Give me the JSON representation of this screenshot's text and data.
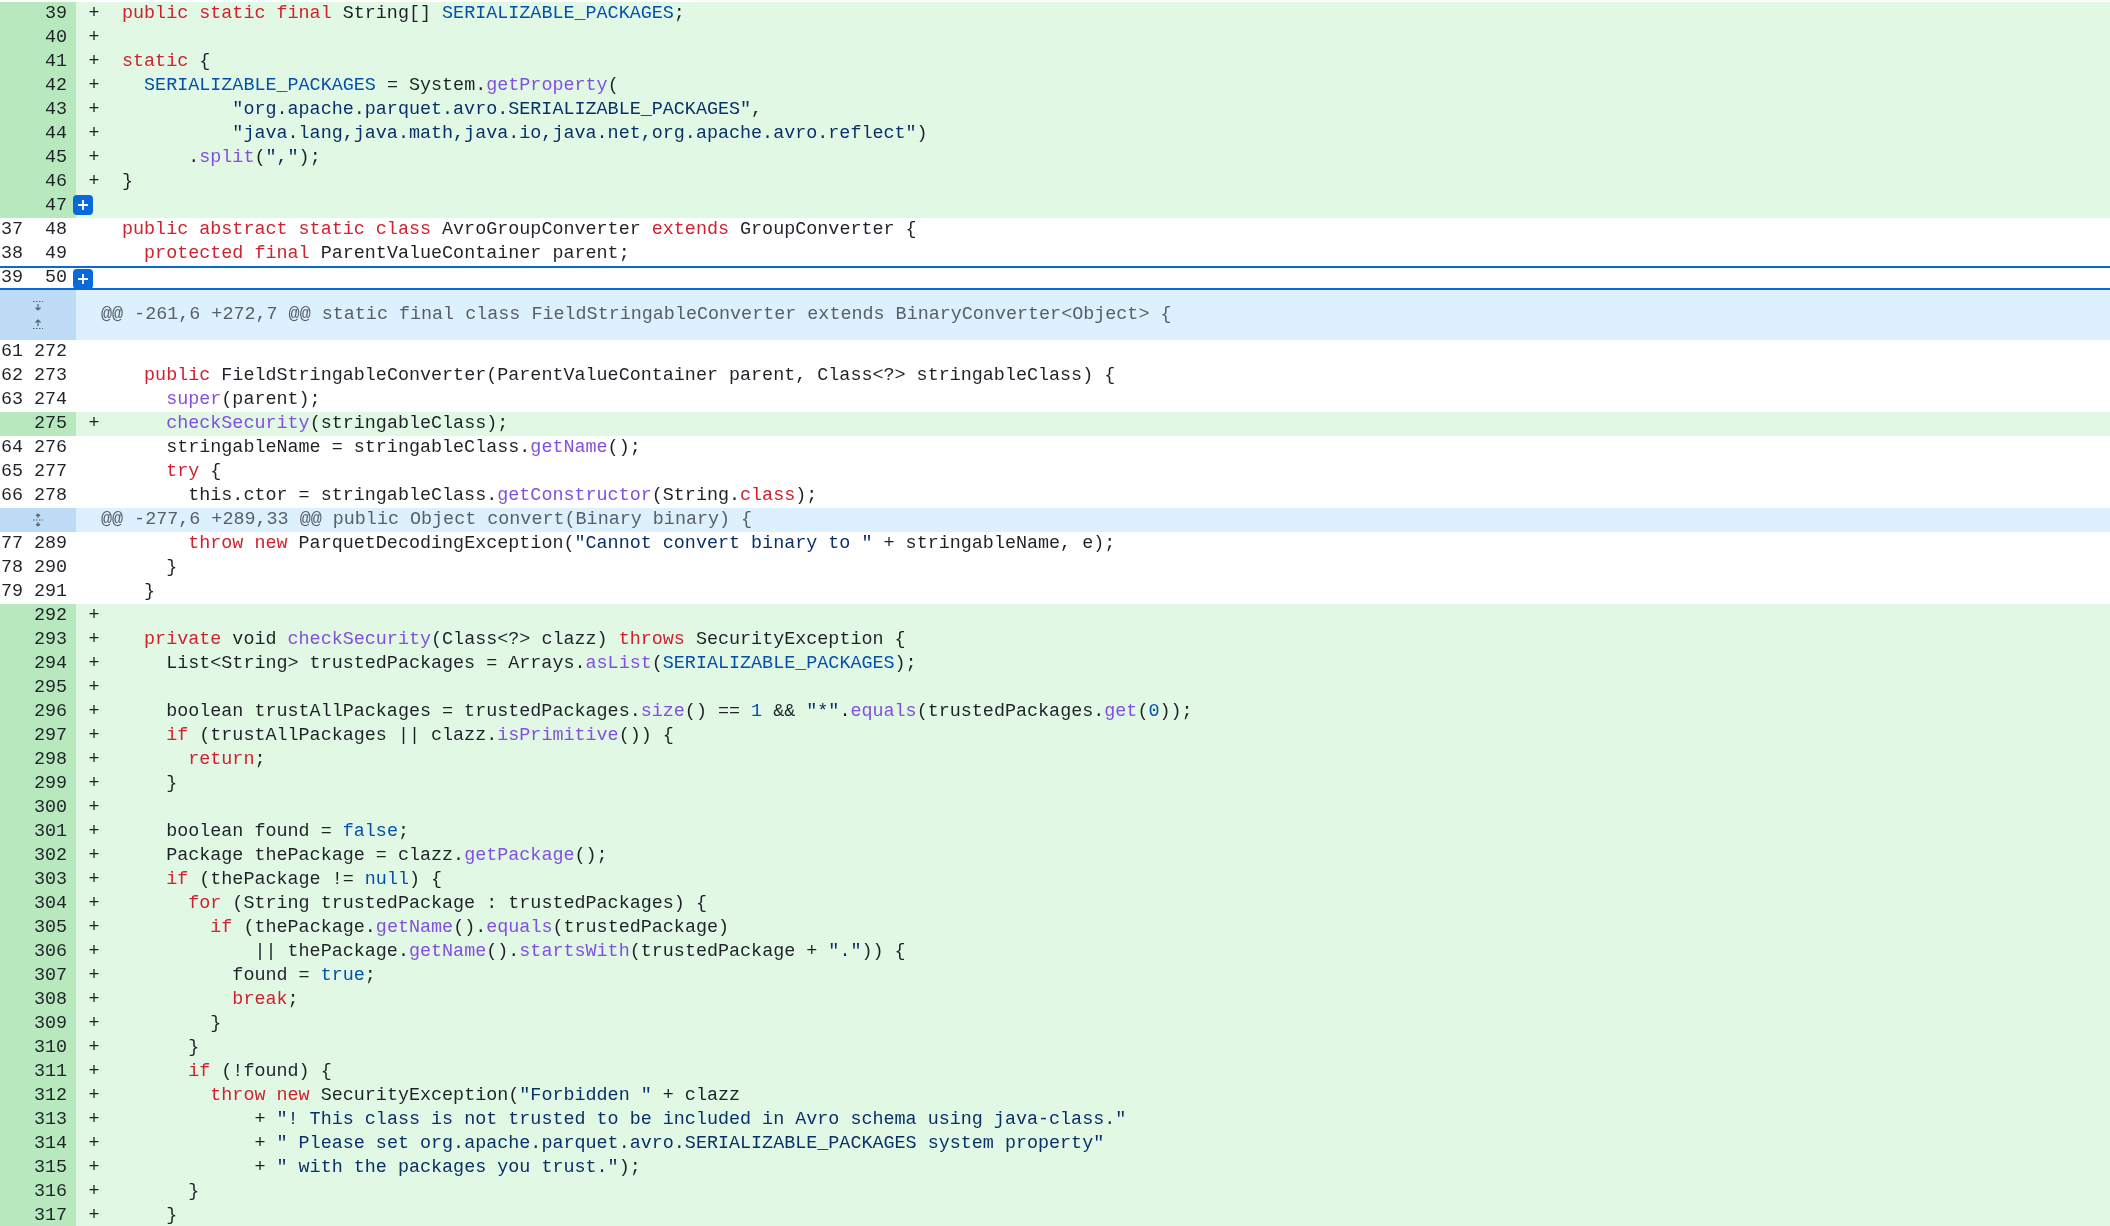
{
  "diff_lines": [
    {
      "kind": "added",
      "new": "39",
      "marker": "+",
      "selected": false,
      "comment_button": false,
      "code": [
        {
          "kind": "kw",
          "text": "public static final"
        },
        {
          "kind": "plain",
          "text": " String[] "
        },
        {
          "kind": "const",
          "text": "SERIALIZABLE_PACKAGES"
        },
        {
          "kind": "plain",
          "text": ";"
        }
      ]
    },
    {
      "kind": "added",
      "new": "40",
      "marker": "+",
      "selected": false,
      "comment_button": false
    },
    {
      "kind": "added",
      "new": "41",
      "marker": "+",
      "selected": false,
      "comment_button": false,
      "code": [
        {
          "kind": "kw",
          "text": "static"
        },
        {
          "kind": "plain",
          "text": " {"
        }
      ]
    },
    {
      "kind": "added",
      "new": "42",
      "marker": "+",
      "selected": false,
      "comment_button": false,
      "code": [
        {
          "kind": "const",
          "text": "  SERIALIZABLE_PACKAGES"
        },
        {
          "kind": "plain",
          "text": " = System."
        },
        {
          "kind": "fn",
          "text": "getProperty"
        },
        {
          "kind": "plain",
          "text": "("
        }
      ]
    },
    {
      "kind": "added",
      "new": "43",
      "marker": "+",
      "selected": false,
      "comment_button": false,
      "code": [
        {
          "kind": "str",
          "text": "          \"org.apache.parquet.avro.SERIALIZABLE_PACKAGES\""
        },
        {
          "kind": "plain",
          "text": ","
        }
      ]
    },
    {
      "kind": "added",
      "new": "44",
      "marker": "+",
      "selected": false,
      "comment_button": false,
      "code": [
        {
          "kind": "str",
          "text": "          \"java.lang,java.math,java.io,java.net,org.apache.avro.reflect\""
        },
        {
          "kind": "plain",
          "text": ")"
        }
      ]
    },
    {
      "kind": "added",
      "new": "45",
      "marker": "+",
      "selected": false,
      "comment_button": false,
      "code": [
        {
          "kind": "plain",
          "text": "      ."
        },
        {
          "kind": "fn",
          "text": "split"
        },
        {
          "kind": "plain",
          "text": "("
        },
        {
          "kind": "str",
          "text": "\",\""
        },
        {
          "kind": "plain",
          "text": ");"
        }
      ]
    },
    {
      "kind": "added",
      "new": "46",
      "marker": "+",
      "selected": false,
      "comment_button": false,
      "code": [
        {
          "kind": "plain",
          "text": "}"
        }
      ]
    },
    {
      "kind": "added",
      "new": "47",
      "selected": false,
      "comment_button": true
    },
    {
      "kind": "context",
      "old": "37",
      "new": "48",
      "selected": false,
      "comment_button": false,
      "code": [
        {
          "kind": "kw",
          "text": "public abstract static class"
        },
        {
          "kind": "plain",
          "text": " AvroGroupConverter "
        },
        {
          "kind": "kw",
          "text": "extends"
        },
        {
          "kind": "plain",
          "text": " GroupConverter {"
        }
      ]
    },
    {
      "kind": "context",
      "old": "38",
      "new": "49",
      "selected": false,
      "comment_button": false,
      "code": [
        {
          "kind": "kw",
          "text": "  protected final"
        },
        {
          "kind": "plain",
          "text": " ParentValueContainer parent;"
        }
      ]
    },
    {
      "kind": "context",
      "old": "39",
      "new": "50",
      "selected": true,
      "comment_button": true
    },
    {
      "kind": "hunk_split",
      "header": "@@ -261,6 +272,7 @@ static final class FieldStringableConverter extends BinaryConverter<Object> {"
    },
    {
      "kind": "context",
      "old": "61",
      "new": "272",
      "selected": false,
      "comment_button": false
    },
    {
      "kind": "context",
      "old": "62",
      "new": "273",
      "selected": false,
      "comment_button": false,
      "code": [
        {
          "kind": "kw",
          "text": "  public"
        },
        {
          "kind": "plain",
          "text": " FieldStringableConverter(ParentValueContainer parent, Class<?> stringableClass) {"
        }
      ]
    },
    {
      "kind": "context",
      "old": "63",
      "new": "274",
      "selected": false,
      "comment_button": false,
      "code": [
        {
          "kind": "fn",
          "text": "    super"
        },
        {
          "kind": "plain",
          "text": "(parent);"
        }
      ]
    },
    {
      "kind": "added",
      "new": "275",
      "marker": "+",
      "selected": false,
      "comment_button": false,
      "code": [
        {
          "kind": "fn",
          "text": "    checkSecurity"
        },
        {
          "kind": "plain",
          "text": "(stringableClass);"
        }
      ]
    },
    {
      "kind": "context",
      "old": "64",
      "new": "276",
      "selected": false,
      "comment_button": false,
      "code": [
        {
          "kind": "plain",
          "text": "    stringableName = stringableClass."
        },
        {
          "kind": "fn",
          "text": "getName"
        },
        {
          "kind": "plain",
          "text": "();"
        }
      ]
    },
    {
      "kind": "context",
      "old": "65",
      "new": "277",
      "selected": false,
      "comment_button": false,
      "code": [
        {
          "kind": "kw",
          "text": "    try"
        },
        {
          "kind": "plain",
          "text": " {"
        }
      ]
    },
    {
      "kind": "context",
      "old": "66",
      "new": "278",
      "selected": false,
      "comment_button": false,
      "code": [
        {
          "kind": "plain",
          "text": "      this.ctor = stringableClass."
        },
        {
          "kind": "fn",
          "text": "getConstructor"
        },
        {
          "kind": "plain",
          "text": "(String."
        },
        {
          "kind": "kw",
          "text": "class"
        },
        {
          "kind": "plain",
          "text": ");"
        }
      ]
    },
    {
      "kind": "hunk_combined",
      "header": "@@ -277,6 +289,33 @@ public Object convert(Binary binary) {"
    },
    {
      "kind": "context",
      "old": "77",
      "new": "289",
      "selected": false,
      "comment_button": false,
      "code": [
        {
          "kind": "kw",
          "text": "      throw new"
        },
        {
          "kind": "plain",
          "text": " ParquetDecodingException("
        },
        {
          "kind": "str",
          "text": "\"Cannot convert binary to \""
        },
        {
          "kind": "plain",
          "text": " + stringableName, e);"
        }
      ]
    },
    {
      "kind": "context",
      "old": "78",
      "new": "290",
      "selected": false,
      "comment_button": false,
      "code": [
        {
          "kind": "plain",
          "text": "    }"
        }
      ]
    },
    {
      "kind": "context",
      "old": "79",
      "new": "291",
      "selected": false,
      "comment_button": false,
      "code": [
        {
          "kind": "plain",
          "text": "  }"
        }
      ]
    },
    {
      "kind": "added",
      "new": "292",
      "marker": "+",
      "selected": false,
      "comment_button": false
    },
    {
      "kind": "added",
      "new": "293",
      "marker": "+",
      "selected": false,
      "comment_button": false,
      "code": [
        {
          "kind": "kw",
          "text": "  private"
        },
        {
          "kind": "plain",
          "text": " void "
        },
        {
          "kind": "fn",
          "text": "checkSecurity"
        },
        {
          "kind": "plain",
          "text": "(Class<?> clazz) "
        },
        {
          "kind": "kw",
          "text": "throws"
        },
        {
          "kind": "plain",
          "text": " SecurityException {"
        }
      ]
    },
    {
      "kind": "added",
      "new": "294",
      "marker": "+",
      "selected": false,
      "comment_button": false,
      "code": [
        {
          "kind": "plain",
          "text": "    List<String> trustedPackages = Arrays."
        },
        {
          "kind": "fn",
          "text": "asList"
        },
        {
          "kind": "plain",
          "text": "("
        },
        {
          "kind": "const",
          "text": "SERIALIZABLE_PACKAGES"
        },
        {
          "kind": "plain",
          "text": ");"
        }
      ]
    },
    {
      "kind": "added",
      "new": "295",
      "marker": "+",
      "selected": false,
      "comment_button": false
    },
    {
      "kind": "added",
      "new": "296",
      "marker": "+",
      "selected": false,
      "comment_button": false,
      "code": [
        {
          "kind": "plain",
          "text": "    boolean trustAllPackages = trustedPackages."
        },
        {
          "kind": "fn",
          "text": "size"
        },
        {
          "kind": "plain",
          "text": "() == "
        },
        {
          "kind": "const",
          "text": "1"
        },
        {
          "kind": "plain",
          "text": " && "
        },
        {
          "kind": "str",
          "text": "\"*\""
        },
        {
          "kind": "plain",
          "text": "."
        },
        {
          "kind": "fn",
          "text": "equals"
        },
        {
          "kind": "plain",
          "text": "(trustedPackages."
        },
        {
          "kind": "fn",
          "text": "get"
        },
        {
          "kind": "plain",
          "text": "("
        },
        {
          "kind": "const",
          "text": "0"
        },
        {
          "kind": "plain",
          "text": "));"
        }
      ]
    },
    {
      "kind": "added",
      "new": "297",
      "marker": "+",
      "selected": false,
      "comment_button": false,
      "code": [
        {
          "kind": "kw",
          "text": "    if"
        },
        {
          "kind": "plain",
          "text": " (trustAllPackages || clazz."
        },
        {
          "kind": "fn",
          "text": "isPrimitive"
        },
        {
          "kind": "plain",
          "text": "()) {"
        }
      ]
    },
    {
      "kind": "added",
      "new": "298",
      "marker": "+",
      "selected": false,
      "comment_button": false,
      "code": [
        {
          "kind": "kw",
          "text": "      return"
        },
        {
          "kind": "plain",
          "text": ";"
        }
      ]
    },
    {
      "kind": "added",
      "new": "299",
      "marker": "+",
      "selected": false,
      "comment_button": false,
      "code": [
        {
          "kind": "plain",
          "text": "    }"
        }
      ]
    },
    {
      "kind": "added",
      "new": "300",
      "marker": "+",
      "selected": false,
      "comment_button": false
    },
    {
      "kind": "added",
      "new": "301",
      "marker": "+",
      "selected": false,
      "comment_button": false,
      "code": [
        {
          "kind": "plain",
          "text": "    boolean found = "
        },
        {
          "kind": "const",
          "text": "false"
        },
        {
          "kind": "plain",
          "text": ";"
        }
      ]
    },
    {
      "kind": "added",
      "new": "302",
      "marker": "+",
      "selected": false,
      "comment_button": false,
      "code": [
        {
          "kind": "plain",
          "text": "    Package thePackage = clazz."
        },
        {
          "kind": "fn",
          "text": "getPackage"
        },
        {
          "kind": "plain",
          "text": "();"
        }
      ]
    },
    {
      "kind": "added",
      "new": "303",
      "marker": "+",
      "selected": false,
      "comment_button": false,
      "code": [
        {
          "kind": "kw",
          "text": "    if"
        },
        {
          "kind": "plain",
          "text": " (thePackage != "
        },
        {
          "kind": "const",
          "text": "null"
        },
        {
          "kind": "plain",
          "text": ") {"
        }
      ]
    },
    {
      "kind": "added",
      "new": "304",
      "marker": "+",
      "selected": false,
      "comment_button": false,
      "code": [
        {
          "kind": "kw",
          "text": "      for"
        },
        {
          "kind": "plain",
          "text": " (String trustedPackage : trustedPackages) {"
        }
      ]
    },
    {
      "kind": "added",
      "new": "305",
      "marker": "+",
      "selected": false,
      "comment_button": false,
      "code": [
        {
          "kind": "kw",
          "text": "        if"
        },
        {
          "kind": "plain",
          "text": " (thePackage."
        },
        {
          "kind": "fn",
          "text": "getName"
        },
        {
          "kind": "plain",
          "text": "()."
        },
        {
          "kind": "fn",
          "text": "equals"
        },
        {
          "kind": "plain",
          "text": "(trustedPackage)"
        }
      ]
    },
    {
      "kind": "added",
      "new": "306",
      "marker": "+",
      "selected": false,
      "comment_button": false,
      "code": [
        {
          "kind": "plain",
          "text": "            || thePackage."
        },
        {
          "kind": "fn",
          "text": "getName"
        },
        {
          "kind": "plain",
          "text": "()."
        },
        {
          "kind": "fn",
          "text": "startsWith"
        },
        {
          "kind": "plain",
          "text": "(trustedPackage + "
        },
        {
          "kind": "str",
          "text": "\".\""
        },
        {
          "kind": "plain",
          "text": ")) {"
        }
      ]
    },
    {
      "kind": "added",
      "new": "307",
      "marker": "+",
      "selected": false,
      "comment_button": false,
      "code": [
        {
          "kind": "plain",
          "text": "          found = "
        },
        {
          "kind": "const",
          "text": "true"
        },
        {
          "kind": "plain",
          "text": ";"
        }
      ]
    },
    {
      "kind": "added",
      "new": "308",
      "marker": "+",
      "selected": false,
      "comment_button": false,
      "code": [
        {
          "kind": "kw",
          "text": "          break"
        },
        {
          "kind": "plain",
          "text": ";"
        }
      ]
    },
    {
      "kind": "added",
      "new": "309",
      "marker": "+",
      "selected": false,
      "comment_button": false,
      "code": [
        {
          "kind": "plain",
          "text": "        }"
        }
      ]
    },
    {
      "kind": "added",
      "new": "310",
      "marker": "+",
      "selected": false,
      "comment_button": false,
      "code": [
        {
          "kind": "plain",
          "text": "      }"
        }
      ]
    },
    {
      "kind": "added",
      "new": "311",
      "marker": "+",
      "selected": false,
      "comment_button": false,
      "code": [
        {
          "kind": "kw",
          "text": "      if"
        },
        {
          "kind": "plain",
          "text": " (!found) {"
        }
      ]
    },
    {
      "kind": "added",
      "new": "312",
      "marker": "+",
      "selected": false,
      "comment_button": false,
      "code": [
        {
          "kind": "kw",
          "text": "        throw new"
        },
        {
          "kind": "plain",
          "text": " SecurityException("
        },
        {
          "kind": "str",
          "text": "\"Forbidden \""
        },
        {
          "kind": "plain",
          "text": " + clazz"
        }
      ]
    },
    {
      "kind": "added",
      "new": "313",
      "marker": "+",
      "selected": false,
      "comment_button": false,
      "code": [
        {
          "kind": "plain",
          "text": "            + "
        },
        {
          "kind": "str",
          "text": "\"! This class is not trusted to be included in Avro schema using java-class.\""
        }
      ]
    },
    {
      "kind": "added",
      "new": "314",
      "marker": "+",
      "selected": false,
      "comment_button": false,
      "code": [
        {
          "kind": "plain",
          "text": "            + "
        },
        {
          "kind": "str",
          "text": "\" Please set org.apache.parquet.avro.SERIALIZABLE_PACKAGES system property\""
        }
      ]
    },
    {
      "kind": "added",
      "new": "315",
      "marker": "+",
      "selected": false,
      "comment_button": false,
      "code": [
        {
          "kind": "plain",
          "text": "            + "
        },
        {
          "kind": "str",
          "text": "\" with the packages you trust.\""
        },
        {
          "kind": "plain",
          "text": ");"
        }
      ]
    },
    {
      "kind": "added",
      "new": "316",
      "marker": "+",
      "selected": false,
      "comment_button": false,
      "code": [
        {
          "kind": "plain",
          "text": "      }"
        }
      ]
    },
    {
      "kind": "added",
      "new": "317",
      "marker": "+",
      "selected": false,
      "comment_button": false,
      "code": [
        {
          "kind": "plain",
          "text": "    }"
        }
      ]
    }
  ]
}
